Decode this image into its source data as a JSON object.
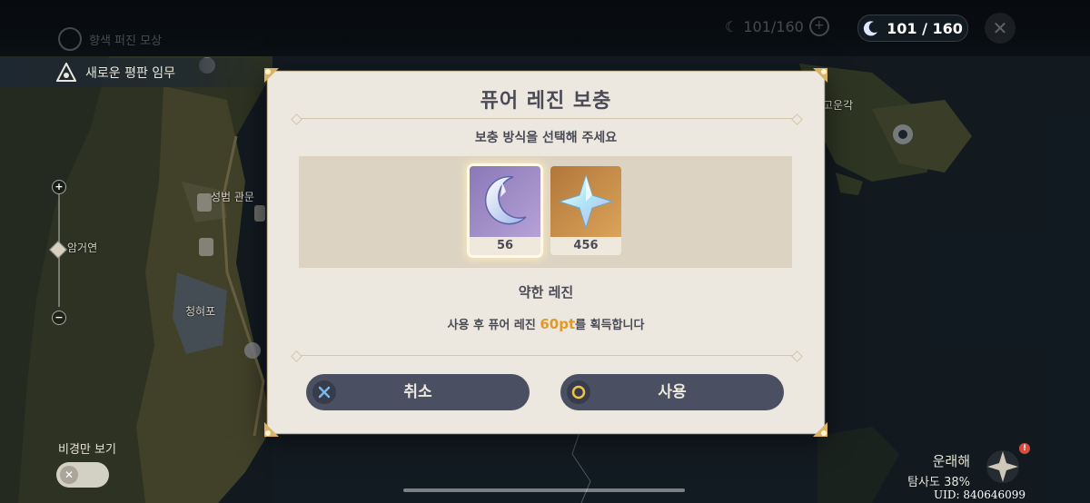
{
  "hud": {
    "quest_faint": "향색 퍼진 모상",
    "quest_active": "새로운 평판 임무",
    "resin_faint": "101/160",
    "resin": "101 / 160"
  },
  "map_labels": {
    "shrine": "성범 관문",
    "cave": "암거연",
    "bay": "청혀포",
    "east": "고운각"
  },
  "scenery": {
    "label": "비경만 보기"
  },
  "region": {
    "name": "운래해",
    "exploration": "탐사도 38%"
  },
  "uid": "UID: 840646099",
  "dialog": {
    "title": "퓨어 레진 보충",
    "subtitle": "보충 방식을 선택해 주세요",
    "items": [
      {
        "name": "약한 레진",
        "count": "56",
        "selected": true,
        "icon": "fragile-resin-icon"
      },
      {
        "count": "456",
        "icon": "primogem-icon"
      }
    ],
    "selected_name": "약한 레진",
    "desc_before": "사용 후 퓨어 레진 ",
    "desc_highlight": "60pt",
    "desc_after": "를 획득합니다",
    "cancel_label": "취소",
    "use_label": "사용"
  },
  "colors": {
    "dialog_bg": "#ece8df",
    "button_bg": "#4a5061",
    "highlight": "#e09a2a",
    "text_dark": "#4a4b57"
  }
}
